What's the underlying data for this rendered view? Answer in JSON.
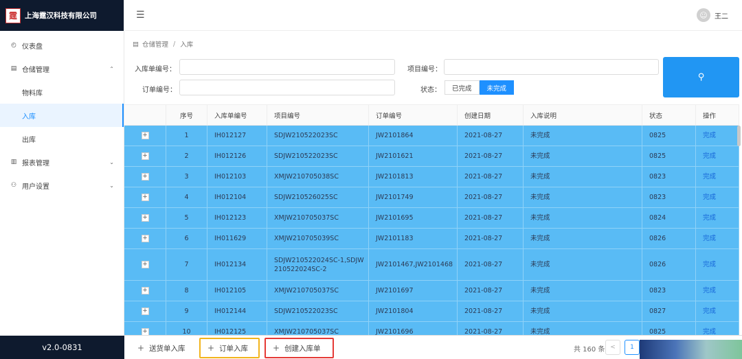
{
  "brand": {
    "company": "上海霆汉科技有限公司",
    "logo_char": "霆"
  },
  "sidebar": {
    "items": [
      {
        "label": "仪表盘",
        "icon": "dashboard-icon",
        "glyph": "◴"
      },
      {
        "label": "仓储管理",
        "icon": "list-icon",
        "glyph": "▤",
        "arrow": "⌃"
      },
      {
        "label": "物料库"
      },
      {
        "label": "入库"
      },
      {
        "label": "出库"
      },
      {
        "label": "报表管理",
        "icon": "chart-icon",
        "glyph": "▥",
        "arrow": "⌄"
      },
      {
        "label": "用户设置",
        "icon": "user-settings-icon",
        "glyph": "⚇",
        "arrow": "⌄"
      }
    ],
    "version": "v2.0-0831"
  },
  "header": {
    "menu_glyph": "☰",
    "user_initial": "☺",
    "user_name": "王二"
  },
  "breadcrumb": {
    "icon": "▤",
    "parent": "仓储管理",
    "sep": "/",
    "current": "入库"
  },
  "filters": {
    "inbound_no_label": "入库单编号：",
    "project_no_label": "项目编号：",
    "order_no_label": "订单编号：",
    "status_label": "状态：",
    "status_done": "已完成",
    "status_undone": "未完成",
    "search_glyph": "⚲"
  },
  "table": {
    "headers": [
      "序号",
      "入库单编号",
      "项目编号",
      "订单编号",
      "创建日期",
      "入库说明",
      "状态",
      "操作"
    ],
    "expand_glyph": "+",
    "rows": [
      {
        "no": "1",
        "in_no": "IH012127",
        "proj": "SDJW210522023SC",
        "ord": "JW2101864",
        "date": "2021-08-27",
        "desc": "未完成",
        "status": "0825",
        "op": "完成"
      },
      {
        "no": "2",
        "in_no": "IH012126",
        "proj": "SDJW210522023SC",
        "ord": "JW2101621",
        "date": "2021-08-27",
        "desc": "未完成",
        "status": "0825",
        "op": "完成"
      },
      {
        "no": "3",
        "in_no": "IH012103",
        "proj": "XMJW210705038SC",
        "ord": "JW2101813",
        "date": "2021-08-27",
        "desc": "未完成",
        "status": "0823",
        "op": "完成"
      },
      {
        "no": "4",
        "in_no": "IH012104",
        "proj": "SDJW210526025SC",
        "ord": "JW2101749",
        "date": "2021-08-27",
        "desc": "未完成",
        "status": "0823",
        "op": "完成"
      },
      {
        "no": "5",
        "in_no": "IH012123",
        "proj": "XMJW210705037SC",
        "ord": "JW2101695",
        "date": "2021-08-27",
        "desc": "未完成",
        "status": "0824",
        "op": "完成"
      },
      {
        "no": "6",
        "in_no": "IH011629",
        "proj": "XMJW210705039SC",
        "ord": "JW2101183",
        "date": "2021-08-27",
        "desc": "未完成",
        "status": "0826",
        "op": "完成"
      },
      {
        "no": "7",
        "in_no": "IH012134",
        "proj": "SDJW210522024SC-1,SDJW 210522024SC-2",
        "ord": "JW2101467,JW2101468",
        "date": "2021-08-27",
        "desc": "未完成",
        "status": "0826",
        "op": "完成"
      },
      {
        "no": "8",
        "in_no": "IH012105",
        "proj": "XMJW210705037SC",
        "ord": "JW2101697",
        "date": "2021-08-27",
        "desc": "未完成",
        "status": "0823",
        "op": "完成"
      },
      {
        "no": "9",
        "in_no": "IH012144",
        "proj": "SDJW210522023SC",
        "ord": "JW2101804",
        "date": "2021-08-27",
        "desc": "未完成",
        "status": "0827",
        "op": "完成"
      },
      {
        "no": "10",
        "in_no": "IH012125",
        "proj": "XMJW210705037SC",
        "ord": "JW2101696",
        "date": "2021-08-27",
        "desc": "未完成",
        "status": "0825",
        "op": "完成"
      }
    ]
  },
  "footer": {
    "btn_delivery": "送货单入库",
    "btn_order": "订单入库",
    "btn_create": "创建入库单",
    "plus": "+",
    "total": "共 160 条",
    "prev_glyph": "<",
    "page": "1"
  },
  "colors": {
    "accent": "#1e90ff",
    "row_selected": "#59bbf5",
    "sidebar_dark": "#0e1a2e",
    "highlight_yellow": "#f2b41c",
    "highlight_red": "#e53935"
  }
}
